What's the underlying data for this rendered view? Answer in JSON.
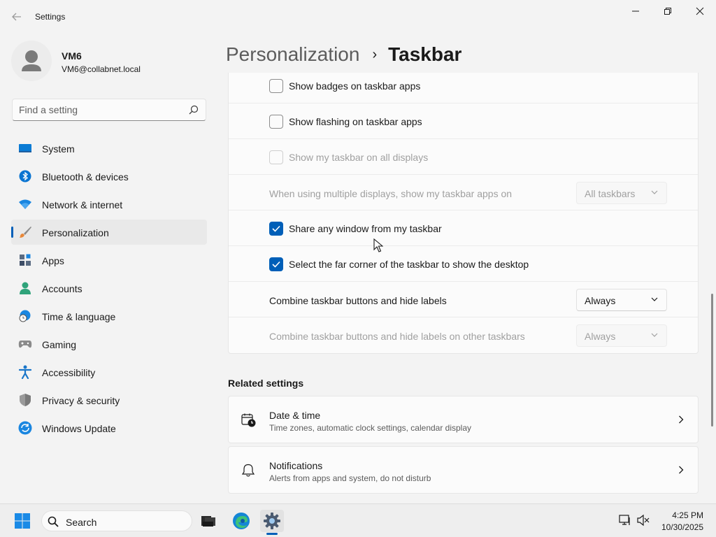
{
  "window": {
    "title": "Settings"
  },
  "user": {
    "name": "VM6",
    "email": "VM6@collabnet.local"
  },
  "search": {
    "placeholder": "Find a setting"
  },
  "sidebar": {
    "items": [
      {
        "label": "System",
        "icon": "system-icon"
      },
      {
        "label": "Bluetooth & devices",
        "icon": "bluetooth-icon"
      },
      {
        "label": "Network & internet",
        "icon": "wifi-icon"
      },
      {
        "label": "Personalization",
        "icon": "brush-icon",
        "selected": true
      },
      {
        "label": "Apps",
        "icon": "apps-icon"
      },
      {
        "label": "Accounts",
        "icon": "person-icon"
      },
      {
        "label": "Time & language",
        "icon": "globe-clock-icon"
      },
      {
        "label": "Gaming",
        "icon": "gamepad-icon"
      },
      {
        "label": "Accessibility",
        "icon": "accessibility-icon"
      },
      {
        "label": "Privacy & security",
        "icon": "shield-icon"
      },
      {
        "label": "Windows Update",
        "icon": "update-icon"
      }
    ]
  },
  "breadcrumb": {
    "parent": "Personalization",
    "separator": "›",
    "current": "Taskbar"
  },
  "settings": [
    {
      "type": "checkbox",
      "label": "Show badges on taskbar apps",
      "checked": false,
      "disabled": false
    },
    {
      "type": "checkbox",
      "label": "Show flashing on taskbar apps",
      "checked": false,
      "disabled": false
    },
    {
      "type": "checkbox",
      "label": "Show my taskbar on all displays",
      "checked": false,
      "disabled": true
    },
    {
      "type": "dropdown",
      "label": "When using multiple displays, show my taskbar apps on",
      "value": "All taskbars",
      "disabled": true
    },
    {
      "type": "checkbox",
      "label": "Share any window from my taskbar",
      "checked": true,
      "disabled": false
    },
    {
      "type": "checkbox",
      "label": "Select the far corner of the taskbar to show the desktop",
      "checked": true,
      "disabled": false
    },
    {
      "type": "dropdown",
      "label": "Combine taskbar buttons and hide labels",
      "value": "Always",
      "disabled": false
    },
    {
      "type": "dropdown",
      "label": "Combine taskbar buttons and hide labels on other taskbars",
      "value": "Always",
      "disabled": true
    }
  ],
  "related": {
    "title": "Related settings",
    "items": [
      {
        "title": "Date & time",
        "description": "Time zones, automatic clock settings, calendar display",
        "icon": "calendar-clock-icon"
      },
      {
        "title": "Notifications",
        "description": "Alerts from apps and system, do not disturb",
        "icon": "bell-icon"
      }
    ]
  },
  "taskbar": {
    "search_label": "Search",
    "time": "4:25 PM",
    "date": "10/30/2025",
    "apps": [
      "file-explorer-icon",
      "edge-icon",
      "settings-gear-icon"
    ]
  },
  "colors": {
    "accent": "#005fb8",
    "background": "#f3f3f3",
    "card": "#fbfbfb"
  }
}
